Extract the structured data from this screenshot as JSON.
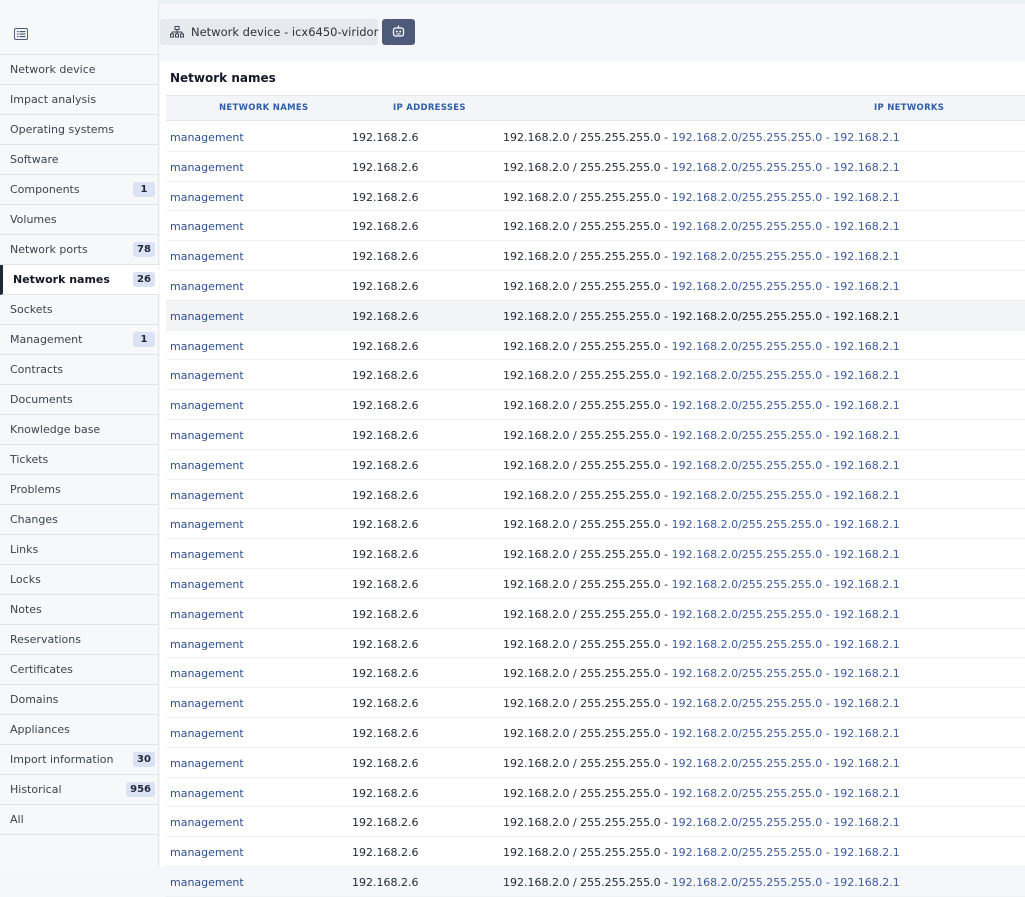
{
  "header": {
    "breadcrumb": "Network device - icx6450-viridor",
    "breadcrumb_icon": "network-device-icon",
    "action_icon": "robot-icon"
  },
  "sidebar": {
    "toggle_icon": "list-icon",
    "items": [
      {
        "label": "Network device",
        "badge": null,
        "active": false
      },
      {
        "label": "Impact analysis",
        "badge": null,
        "active": false
      },
      {
        "label": "Operating systems",
        "badge": null,
        "active": false
      },
      {
        "label": "Software",
        "badge": null,
        "active": false
      },
      {
        "label": "Components",
        "badge": "1",
        "active": false
      },
      {
        "label": "Volumes",
        "badge": null,
        "active": false
      },
      {
        "label": "Network ports",
        "badge": "78",
        "active": false
      },
      {
        "label": "Network names",
        "badge": "26",
        "active": true
      },
      {
        "label": "Sockets",
        "badge": null,
        "active": false
      },
      {
        "label": "Management",
        "badge": "1",
        "active": false
      },
      {
        "label": "Contracts",
        "badge": null,
        "active": false
      },
      {
        "label": "Documents",
        "badge": null,
        "active": false
      },
      {
        "label": "Knowledge base",
        "badge": null,
        "active": false
      },
      {
        "label": "Tickets",
        "badge": null,
        "active": false
      },
      {
        "label": "Problems",
        "badge": null,
        "active": false
      },
      {
        "label": "Changes",
        "badge": null,
        "active": false
      },
      {
        "label": "Links",
        "badge": null,
        "active": false
      },
      {
        "label": "Locks",
        "badge": null,
        "active": false
      },
      {
        "label": "Notes",
        "badge": null,
        "active": false
      },
      {
        "label": "Reservations",
        "badge": null,
        "active": false
      },
      {
        "label": "Certificates",
        "badge": null,
        "active": false
      },
      {
        "label": "Domains",
        "badge": null,
        "active": false
      },
      {
        "label": "Appliances",
        "badge": null,
        "active": false
      },
      {
        "label": "Import information",
        "badge": "30",
        "active": false
      },
      {
        "label": "Historical",
        "badge": "956",
        "active": false
      },
      {
        "label": "All",
        "badge": null,
        "active": false
      }
    ]
  },
  "main": {
    "title": "Network names",
    "columns": {
      "names": "NETWORK NAMES",
      "ips": "IP ADDRESSES",
      "networks": "IP NETWORKS"
    },
    "row_template": {
      "name": "management",
      "ip": "192.168.2.6",
      "network_prefix": "192.168.2.0 / 255.255.255.0 - ",
      "network_link": "192.168.2.0/255.255.255.0 - 192.168.2.1"
    },
    "rows": [
      {
        "name": "management",
        "ip": "192.168.2.6",
        "net": "192.168.2.0 / 255.255.255.0 - ",
        "link": "192.168.2.0/255.255.255.0 - 192.168.2.1"
      },
      {
        "name": "management",
        "ip": "192.168.2.6",
        "net": "192.168.2.0 / 255.255.255.0 - ",
        "link": "192.168.2.0/255.255.255.0 - 192.168.2.1"
      },
      {
        "name": "management",
        "ip": "192.168.2.6",
        "net": "192.168.2.0 / 255.255.255.0 - ",
        "link": "192.168.2.0/255.255.255.0 - 192.168.2.1"
      },
      {
        "name": "management",
        "ip": "192.168.2.6",
        "net": "192.168.2.0 / 255.255.255.0 - ",
        "link": "192.168.2.0/255.255.255.0 - 192.168.2.1"
      },
      {
        "name": "management",
        "ip": "192.168.2.6",
        "net": "192.168.2.0 / 255.255.255.0 - ",
        "link": "192.168.2.0/255.255.255.0 - 192.168.2.1"
      },
      {
        "name": "management",
        "ip": "192.168.2.6",
        "net": "192.168.2.0 / 255.255.255.0 - ",
        "link": "192.168.2.0/255.255.255.0 - 192.168.2.1"
      },
      {
        "name": "management",
        "ip": "192.168.2.6",
        "net": "192.168.2.0 / 255.255.255.0 - 192.168.2.0/255.255.255.0 - 192.168.2.1",
        "link": "",
        "hover": true
      },
      {
        "name": "management",
        "ip": "192.168.2.6",
        "net": "192.168.2.0 / 255.255.255.0 - ",
        "link": "192.168.2.0/255.255.255.0 - 192.168.2.1"
      },
      {
        "name": "management",
        "ip": "192.168.2.6",
        "net": "192.168.2.0 / 255.255.255.0 - ",
        "link": "192.168.2.0/255.255.255.0 - 192.168.2.1"
      },
      {
        "name": "management",
        "ip": "192.168.2.6",
        "net": "192.168.2.0 / 255.255.255.0 - ",
        "link": "192.168.2.0/255.255.255.0 - 192.168.2.1"
      },
      {
        "name": "management",
        "ip": "192.168.2.6",
        "net": "192.168.2.0 / 255.255.255.0 - ",
        "link": "192.168.2.0/255.255.255.0 - 192.168.2.1"
      },
      {
        "name": "management",
        "ip": "192.168.2.6",
        "net": "192.168.2.0 / 255.255.255.0 - ",
        "link": "192.168.2.0/255.255.255.0 - 192.168.2.1"
      },
      {
        "name": "management",
        "ip": "192.168.2.6",
        "net": "192.168.2.0 / 255.255.255.0 - ",
        "link": "192.168.2.0/255.255.255.0 - 192.168.2.1"
      },
      {
        "name": "management",
        "ip": "192.168.2.6",
        "net": "192.168.2.0 / 255.255.255.0 - ",
        "link": "192.168.2.0/255.255.255.0 - 192.168.2.1"
      },
      {
        "name": "management",
        "ip": "192.168.2.6",
        "net": "192.168.2.0 / 255.255.255.0 - ",
        "link": "192.168.2.0/255.255.255.0 - 192.168.2.1"
      },
      {
        "name": "management",
        "ip": "192.168.2.6",
        "net": "192.168.2.0 / 255.255.255.0 - ",
        "link": "192.168.2.0/255.255.255.0 - 192.168.2.1"
      },
      {
        "name": "management",
        "ip": "192.168.2.6",
        "net": "192.168.2.0 / 255.255.255.0 - ",
        "link": "192.168.2.0/255.255.255.0 - 192.168.2.1"
      },
      {
        "name": "management",
        "ip": "192.168.2.6",
        "net": "192.168.2.0 / 255.255.255.0 - ",
        "link": "192.168.2.0/255.255.255.0 - 192.168.2.1"
      },
      {
        "name": "management",
        "ip": "192.168.2.6",
        "net": "192.168.2.0 / 255.255.255.0 - ",
        "link": "192.168.2.0/255.255.255.0 - 192.168.2.1"
      },
      {
        "name": "management",
        "ip": "192.168.2.6",
        "net": "192.168.2.0 / 255.255.255.0 - ",
        "link": "192.168.2.0/255.255.255.0 - 192.168.2.1"
      },
      {
        "name": "management",
        "ip": "192.168.2.6",
        "net": "192.168.2.0 / 255.255.255.0 - ",
        "link": "192.168.2.0/255.255.255.0 - 192.168.2.1"
      },
      {
        "name": "management",
        "ip": "192.168.2.6",
        "net": "192.168.2.0 / 255.255.255.0 - ",
        "link": "192.168.2.0/255.255.255.0 - 192.168.2.1"
      },
      {
        "name": "management",
        "ip": "192.168.2.6",
        "net": "192.168.2.0 / 255.255.255.0 - ",
        "link": "192.168.2.0/255.255.255.0 - 192.168.2.1"
      },
      {
        "name": "management",
        "ip": "192.168.2.6",
        "net": "192.168.2.0 / 255.255.255.0 - ",
        "link": "192.168.2.0/255.255.255.0 - 192.168.2.1"
      },
      {
        "name": "management",
        "ip": "192.168.2.6",
        "net": "192.168.2.0 / 255.255.255.0 - ",
        "link": "192.168.2.0/255.255.255.0 - 192.168.2.1"
      },
      {
        "name": "management",
        "ip": "192.168.2.6",
        "net": "192.168.2.0 / 255.255.255.0 - ",
        "link": "192.168.2.0/255.255.255.0 - 192.168.2.1"
      }
    ]
  }
}
